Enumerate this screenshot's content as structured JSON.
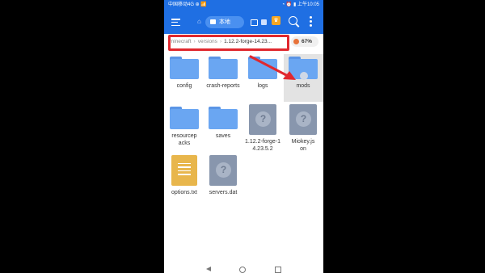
{
  "status_bar": {
    "left": "中国移动4G ⊕ 📶",
    "right": "◔ ⏰ ▮ 上午10:05"
  },
  "header": {
    "tab_label": "本地",
    "vip_icon": "crown-icon"
  },
  "breadcrumb": {
    "items": [
      ".minecraft",
      "versions",
      "1.12.2-forge-14.23..."
    ]
  },
  "storage": {
    "percent_label": "67%"
  },
  "files": [
    {
      "name": "config",
      "type": "folder"
    },
    {
      "name": "crash-reports",
      "type": "folder"
    },
    {
      "name": "logs",
      "type": "folder"
    },
    {
      "name": "mods",
      "type": "folder"
    },
    {
      "name": "resourcepacks",
      "type": "folder"
    },
    {
      "name": "saves",
      "type": "folder"
    },
    {
      "name": "1.12.2-forge-14.23.5.2",
      "type": "unknown"
    },
    {
      "name": "Miokey.json",
      "type": "unknown"
    },
    {
      "name": "options.txt",
      "type": "text"
    },
    {
      "name": "servers.dat",
      "type": "unknown"
    }
  ],
  "colors": {
    "accent": "#1f6fe3",
    "highlight": "#e0282e",
    "folder": "#6aa6f2"
  }
}
